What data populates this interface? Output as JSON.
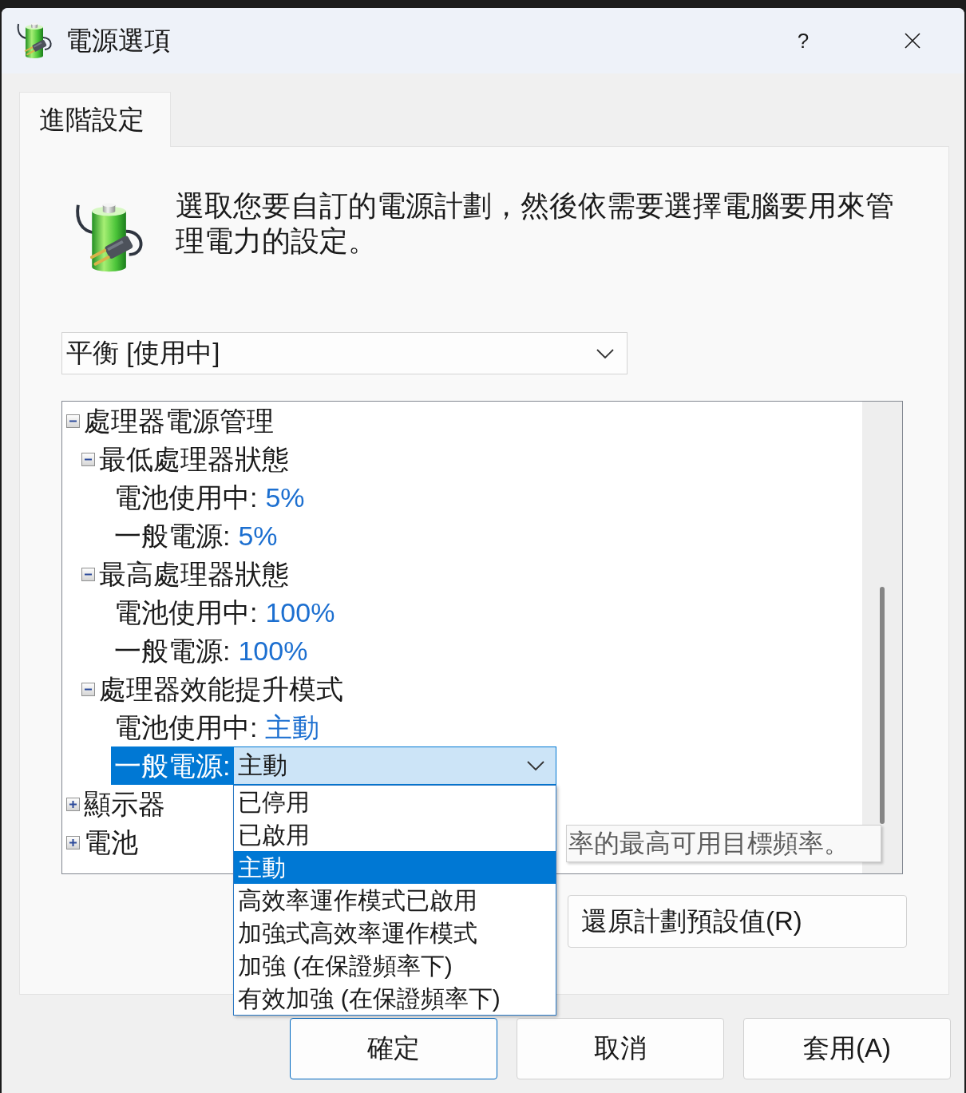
{
  "window": {
    "title": "電源選項",
    "help_button": "?"
  },
  "tabs": [
    {
      "label": "進階設定",
      "selected": true
    }
  ],
  "description": "選取您要自訂的電源計劃，然後依需要選擇電腦要用來管理電力的設定。",
  "plan_select": {
    "value": "平衡 [使用中]"
  },
  "tree": {
    "items": [
      {
        "label": "處理器電源管理",
        "expanded": true,
        "selected": false,
        "children": [
          {
            "label": "最低處理器狀態",
            "expanded": true,
            "selected": false,
            "children": [
              {
                "label": "電池使用中:",
                "value": "5%",
                "selected": false
              },
              {
                "label": "一般電源:",
                "value": "5%",
                "selected": false
              }
            ]
          },
          {
            "label": "最高處理器狀態",
            "expanded": true,
            "selected": false,
            "children": [
              {
                "label": "電池使用中:",
                "value": "100%",
                "selected": false
              },
              {
                "label": "一般電源:",
                "value": "100%",
                "selected": false
              }
            ]
          },
          {
            "label": "處理器效能提升模式",
            "expanded": true,
            "selected": false,
            "children": [
              {
                "label": "電池使用中:",
                "value": "主動",
                "selected": false
              },
              {
                "label": "一般電源:",
                "value": "主動",
                "selected": true,
                "dropdown": {
                  "expanded": true,
                  "options": [
                    {
                      "label": "已停用",
                      "selected": false
                    },
                    {
                      "label": "已啟用",
                      "selected": false
                    },
                    {
                      "label": "主動",
                      "selected": true
                    },
                    {
                      "label": "高效率運作模式已啟用",
                      "selected": false
                    },
                    {
                      "label": "加強式高效率運作模式",
                      "selected": false
                    },
                    {
                      "label": "加強 (在保證頻率下)",
                      "selected": false
                    },
                    {
                      "label": "有效加強 (在保證頻率下)",
                      "selected": false
                    }
                  ]
                }
              }
            ]
          }
        ]
      },
      {
        "label": "顯示器",
        "expanded": false,
        "selected": false
      },
      {
        "label": "電池",
        "expanded": false,
        "selected": false
      }
    ]
  },
  "tooltip": {
    "text": "率的最高可用目標頻率。"
  },
  "restore_button": {
    "label": "還原計劃預設值(R)"
  },
  "buttons": [
    {
      "label": "確定",
      "default": true
    },
    {
      "label": "取消",
      "default": false
    },
    {
      "label": "套用(A)",
      "default": false
    }
  ]
}
